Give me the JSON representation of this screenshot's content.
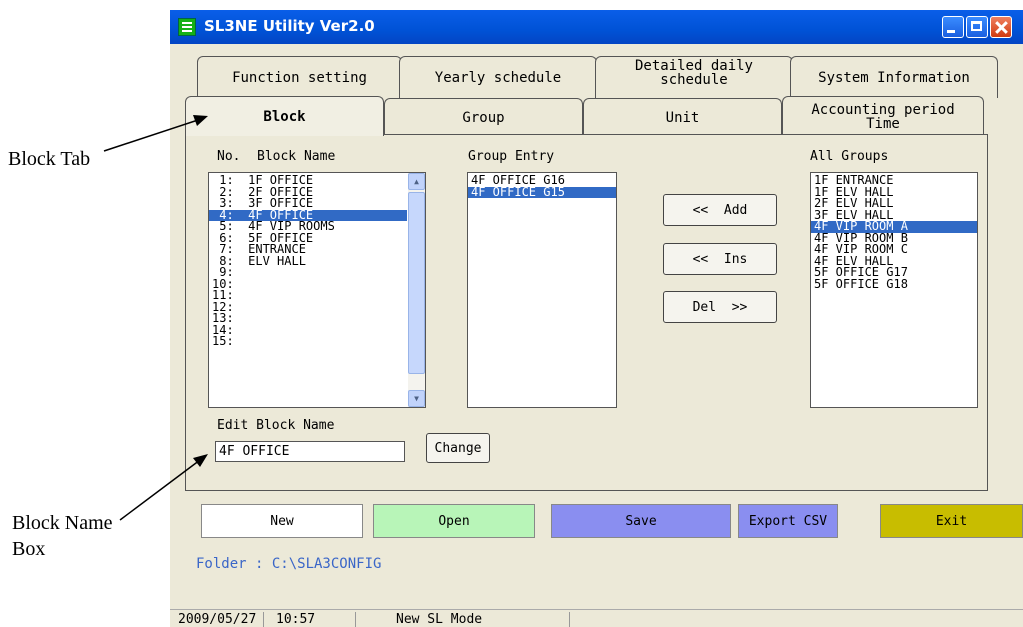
{
  "annotations": {
    "block_tab": "Block Tab",
    "block_name_box_line1": "Block  Name",
    "block_name_box_line2": "Box"
  },
  "window": {
    "title": "SL3NE Utility Ver2.0"
  },
  "tabs_row1": [
    {
      "label": "Function setting"
    },
    {
      "label": "Yearly schedule"
    },
    {
      "label": "Detailed daily\nschedule"
    },
    {
      "label": "System Information"
    }
  ],
  "tabs_row2": [
    {
      "label": "Block"
    },
    {
      "label": "Group"
    },
    {
      "label": "Unit"
    },
    {
      "label": "Accounting period\nTime"
    }
  ],
  "block_panel": {
    "col_no": "No.",
    "col_block_name": "Block Name",
    "blocks": [
      {
        "text": " 1:  1F OFFICE",
        "selected": false
      },
      {
        "text": " 2:  2F OFFICE",
        "selected": false
      },
      {
        "text": " 3:  3F OFFICE",
        "selected": false
      },
      {
        "text": " 4:  4F OFFICE",
        "selected": true
      },
      {
        "text": " 5:  4F VIP ROOMS",
        "selected": false
      },
      {
        "text": " 6:  5F OFFICE",
        "selected": false
      },
      {
        "text": " 7:  ENTRANCE",
        "selected": false
      },
      {
        "text": " 8:  ELV HALL",
        "selected": false
      },
      {
        "text": " 9:",
        "selected": false
      },
      {
        "text": "10:",
        "selected": false
      },
      {
        "text": "11:",
        "selected": false
      },
      {
        "text": "12:",
        "selected": false
      },
      {
        "text": "13:",
        "selected": false
      },
      {
        "text": "14:",
        "selected": false
      },
      {
        "text": "15:",
        "selected": false
      }
    ],
    "group_entry_label": "Group Entry",
    "group_entries": [
      {
        "text": "4F OFFICE G16",
        "selected": false
      },
      {
        "text": "4F OFFICE G15",
        "selected": true
      }
    ],
    "all_groups_label": "All Groups",
    "all_groups": [
      {
        "text": "1F ENTRANCE",
        "selected": false
      },
      {
        "text": "1F ELV HALL",
        "selected": false
      },
      {
        "text": "2F ELV HALL",
        "selected": false
      },
      {
        "text": "3F ELV HALL",
        "selected": false
      },
      {
        "text": "4F VIP ROOM A",
        "selected": true
      },
      {
        "text": "4F VIP ROOM B",
        "selected": false
      },
      {
        "text": "4F VIP ROOM C",
        "selected": false
      },
      {
        "text": "4F ELV HALL",
        "selected": false
      },
      {
        "text": "5F OFFICE G17",
        "selected": false
      },
      {
        "text": "5F OFFICE G18",
        "selected": false
      }
    ],
    "add_button": "<<  Add",
    "ins_button": "<<  Ins",
    "del_button": "Del  >>",
    "edit_block_name_label": "Edit Block Name",
    "edit_block_name_value": "4F OFFICE",
    "change_button": "Change"
  },
  "bottom_buttons": {
    "new": "New",
    "open": "Open",
    "save": "Save",
    "export": "Export CSV",
    "exit": "Exit"
  },
  "colors": {
    "open_bg": "#b8f5b8",
    "save_bg": "#8a8ef0",
    "export_bg": "#8a8ef0",
    "exit_bg": "#c8bd00",
    "selection": "#316ac5"
  },
  "folder_text": "Folder : C:\\SLA3CONFIG",
  "status": {
    "date": "2009/05/27",
    "time": "10:57",
    "mode": "New SL Mode"
  }
}
